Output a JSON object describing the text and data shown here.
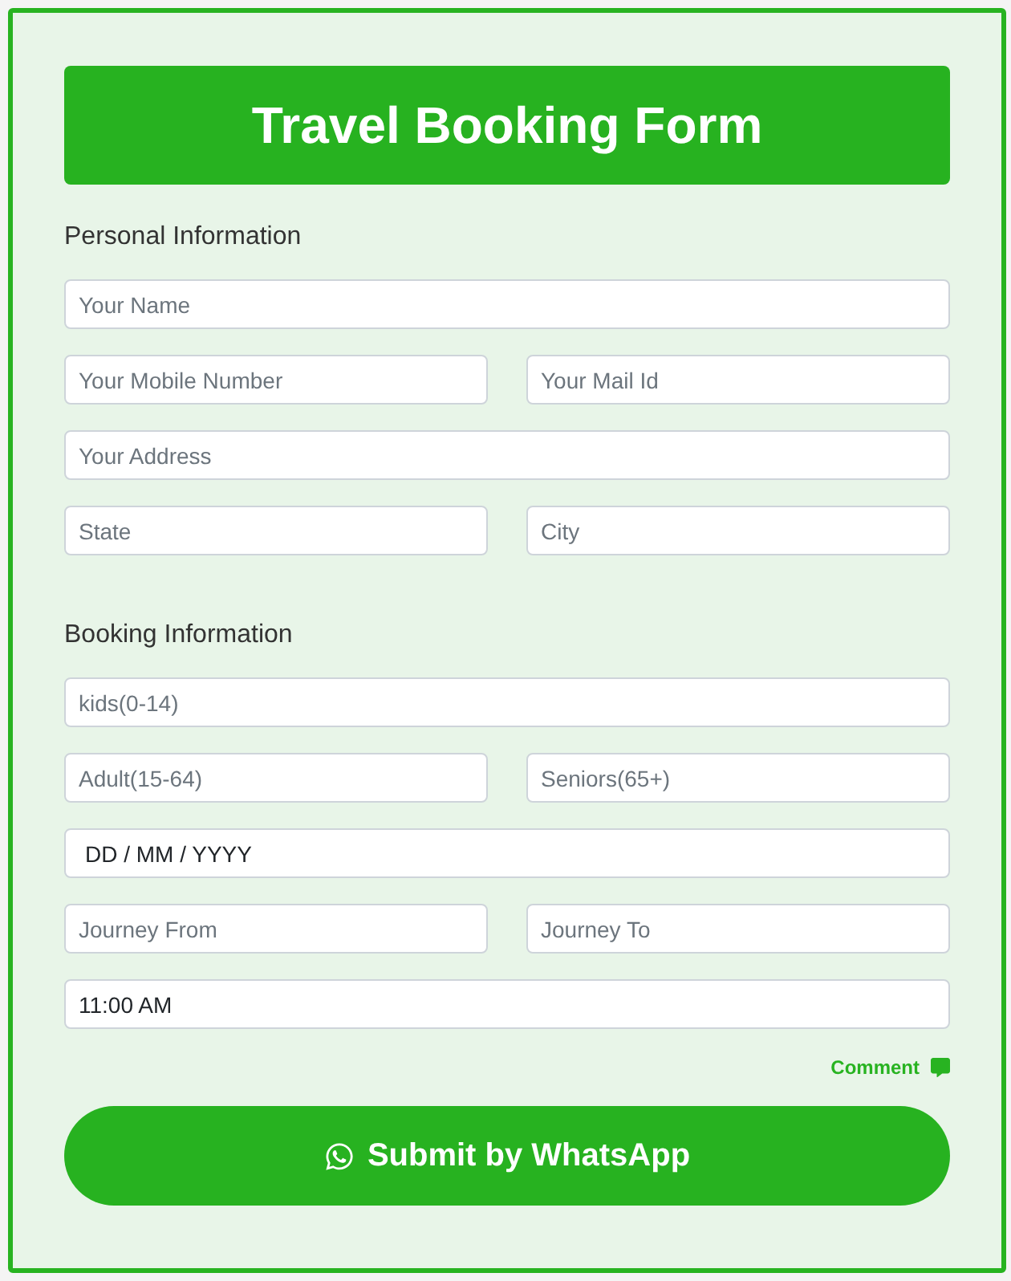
{
  "header": {
    "title": "Travel Booking Form"
  },
  "sections": [
    {
      "heading": "Personal Information",
      "rows": [
        [
          {
            "kind": "text",
            "placeholder": "Your Name"
          }
        ],
        [
          {
            "kind": "text",
            "placeholder": "Your Mobile Number"
          },
          {
            "kind": "text",
            "placeholder": "Your Mail Id"
          }
        ],
        [
          {
            "kind": "text",
            "placeholder": "Your Address"
          }
        ],
        [
          {
            "kind": "text",
            "placeholder": "State"
          },
          {
            "kind": "text",
            "placeholder": "City"
          }
        ]
      ]
    },
    {
      "heading": "Booking Information",
      "rows": [
        [
          {
            "kind": "text",
            "placeholder": "kids(0-14)"
          }
        ],
        [
          {
            "kind": "text",
            "placeholder": "Adult(15-64)"
          },
          {
            "kind": "text",
            "placeholder": "Seniors(65+)"
          }
        ],
        [
          {
            "kind": "date",
            "value": "DD / MM / YYYY"
          }
        ],
        [
          {
            "kind": "text",
            "placeholder": "Journey From"
          },
          {
            "kind": "text",
            "placeholder": "Journey To"
          }
        ],
        [
          {
            "kind": "time",
            "value": "11:00 AM"
          }
        ]
      ]
    }
  ],
  "comment_link": {
    "label": "Comment"
  },
  "submit_button": {
    "label": "Submit by WhatsApp"
  }
}
